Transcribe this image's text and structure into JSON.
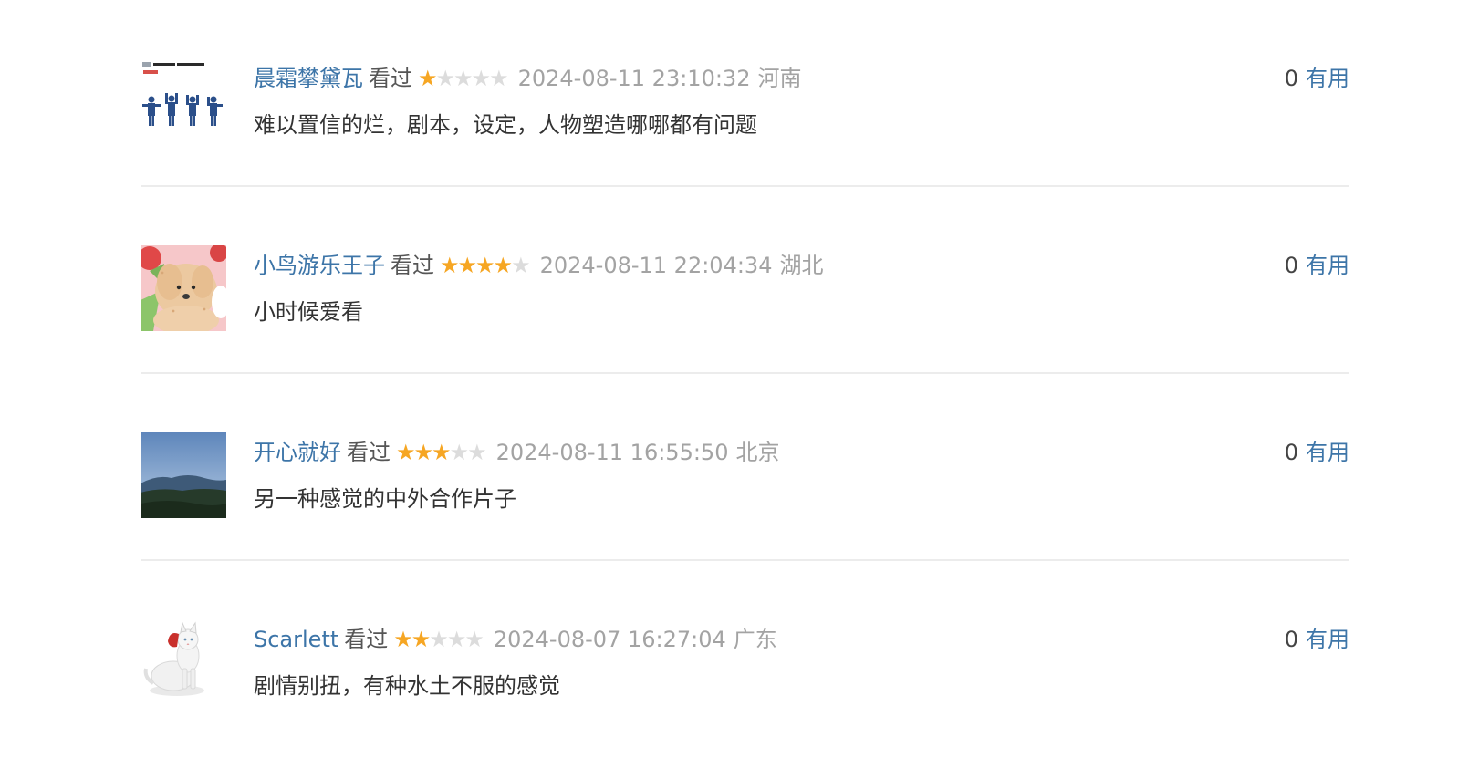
{
  "comments": [
    {
      "username": "晨霜攀黛瓦",
      "status": "看过",
      "rating": 1,
      "time": "2024-08-11 23:10:32",
      "location": "河南",
      "content": "难以置信的烂，剧本，设定，人物塑造哪哪都有问题",
      "votes": "0",
      "useful_label": "有用",
      "avatar": "beatles-album-avatar"
    },
    {
      "username": "小鸟游乐王子",
      "status": "看过",
      "rating": 4,
      "time": "2024-08-11 22:04:34",
      "location": "湖北",
      "content": "小时候爱看",
      "votes": "0",
      "useful_label": "有用",
      "avatar": "puppy-illustration-avatar"
    },
    {
      "username": "开心就好",
      "status": "看过",
      "rating": 3,
      "time": "2024-08-11 16:55:50",
      "location": "北京",
      "content": "另一种感觉的中外合作片子",
      "votes": "0",
      "useful_label": "有用",
      "avatar": "mountain-landscape-avatar"
    },
    {
      "username": "Scarlett",
      "status": "看过",
      "rating": 2,
      "time": "2024-08-07 16:27:04",
      "location": "广东",
      "content": "剧情别扭，有种水土不服的感觉",
      "votes": "0",
      "useful_label": "有用",
      "avatar": "white-cat-avatar"
    }
  ],
  "colors": {
    "link": "#3d75a8",
    "star_on": "#f6a623",
    "star_off": "#dcdcdc",
    "meta": "#a3a3a3",
    "divider": "#ececec"
  },
  "max_rating": 5
}
